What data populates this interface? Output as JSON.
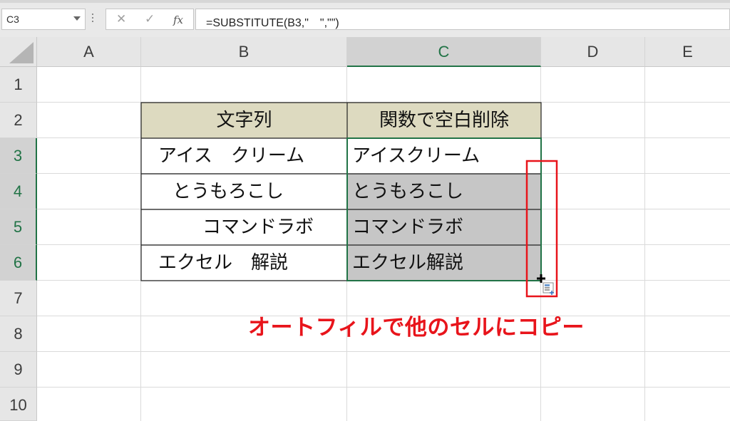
{
  "formula_bar": {
    "name_box": "C3",
    "cancel_icon": "cancel-icon",
    "enter_icon": "enter-icon",
    "function_label": "fx",
    "formula": "=SUBSTITUTE(B3,\"　\",\"\")"
  },
  "columns": [
    "A",
    "B",
    "C",
    "D",
    "E"
  ],
  "rows": [
    "1",
    "2",
    "3",
    "4",
    "5",
    "6",
    "7",
    "8",
    "9",
    "10"
  ],
  "table": {
    "header_b": "文字列",
    "header_c": "関数で空白削除",
    "col_b": [
      "アイス　クリーム",
      "　とうもろこし",
      "　　　コマンドラボ",
      "エクセル　解説"
    ],
    "col_c": [
      "アイスクリーム",
      "とうもろこし",
      "コマンドラボ",
      "エクセル解説"
    ]
  },
  "annotation": "オートフィルで他のセルにコピー",
  "colors": {
    "accent": "#217346",
    "annotation": "#e8141b",
    "header_fill": "#dddac0",
    "fill_gray": "#c6c6c6"
  }
}
